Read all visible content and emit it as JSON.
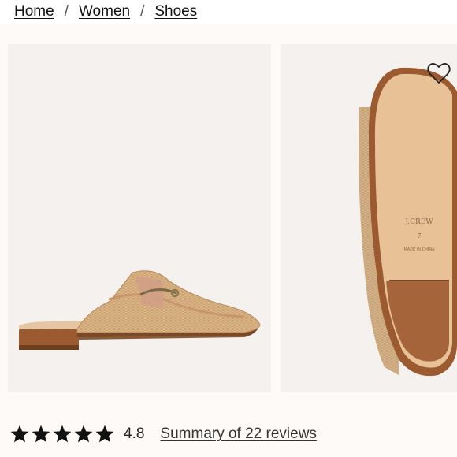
{
  "breadcrumb": {
    "items": [
      "Home",
      "Women",
      "Shoes"
    ],
    "separator": "/"
  },
  "gallery": {
    "images": [
      {
        "alt": "product-side-view"
      },
      {
        "alt": "product-sole-view"
      }
    ],
    "sole_text": {
      "brand": "J.CREW",
      "size": "7",
      "origin": "MADE IN CHINA"
    },
    "favorite_icon": "heart-outline-icon"
  },
  "rating": {
    "value": "4.8",
    "stars_filled": 5,
    "reviews_label": "Summary of 22 reviews"
  },
  "colors": {
    "raffia": "#ddb88a",
    "leather": "#d2a185",
    "sole_tan": "#e8c196",
    "heel_brown": "#9b5a2f",
    "panel_bg": "#f4f1ee"
  }
}
